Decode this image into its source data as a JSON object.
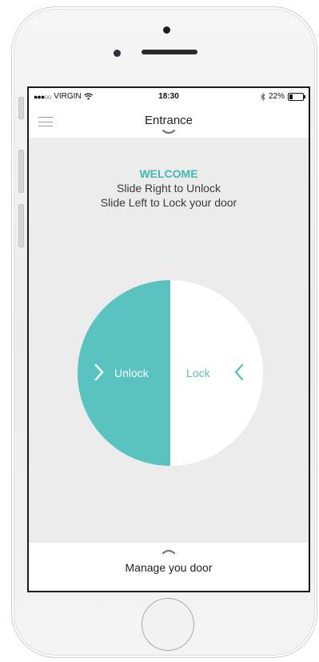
{
  "status_bar": {
    "carrier_dots": "●●●○○",
    "carrier": "VIRGIN",
    "wifi_icon": "wifi-icon",
    "time": "18:30",
    "bluetooth_icon": "bluetooth-icon",
    "battery_percent": "22%",
    "battery_level": 0.22
  },
  "nav": {
    "title": "Entrance",
    "menu_icon": "hamburger-icon"
  },
  "intro": {
    "welcome": "WELCOME",
    "line1": "Slide Right to Unlock",
    "line2": "Slide Left to Lock your door"
  },
  "dial": {
    "unlock_label": "Unlock",
    "lock_label": "Lock"
  },
  "bottom": {
    "label": "Manage you door"
  },
  "colors": {
    "accent": "#5bc3bf",
    "welcome": "#3fb8b2",
    "screen_bg": "#ececec"
  }
}
